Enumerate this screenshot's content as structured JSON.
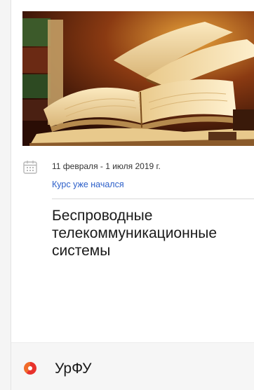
{
  "course": {
    "dates": "11 февраля - 1 июля 2019 г.",
    "status": "Курс уже начался",
    "title_lines": [
      "Беспроводные",
      "телекоммуникационные",
      "системы"
    ]
  },
  "university": {
    "name": "УрФУ"
  },
  "icons": {
    "calendar": "calendar-icon",
    "chevron": "chevron-down-icon",
    "logo": "urfu-logo-icon"
  },
  "colors": {
    "status_link": "#2c5fc9",
    "footer_bg": "#f6f6f6",
    "logo_red": "#e8322c"
  }
}
